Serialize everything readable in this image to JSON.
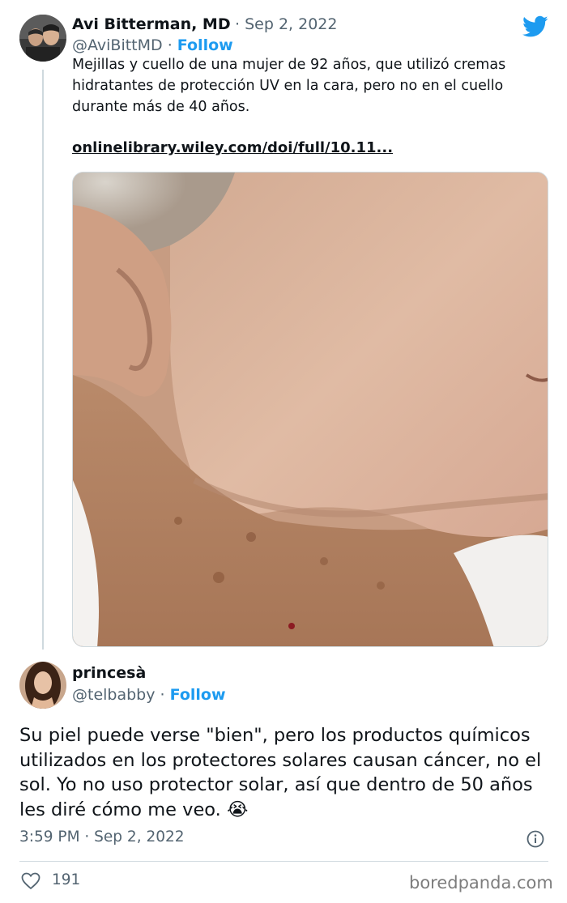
{
  "quoted_tweet": {
    "author_name": "Avi Bitterman, MD",
    "separator": "·",
    "date": "Sep 2, 2022",
    "handle": "@AviBittMD",
    "follow_label": "Follow",
    "text": "Mejillas y cuello de una mujer de 92 años, que utilizó cremas hidratantes de protección UV en la cara, pero no en el cuello durante más de 40 años.",
    "link_text": "onlinelibrary.wiley.com/doi/full/10.11..."
  },
  "reply_tweet": {
    "author_name": "princesà",
    "handle": "@telbabby",
    "separator": "·",
    "follow_label": "Follow",
    "text": "Su piel puede verse \"bien\", pero los productos químicos utilizados en los protectores solares causan cáncer, no el sol. Yo no uso protector solar, así que dentro de 50 años les diré cómo me veo. 😭",
    "timestamp": "3:59 PM · Sep 2, 2022",
    "likes": "191"
  },
  "watermark": "boredpanda.com",
  "icons": {
    "brand": "twitter-bird-icon",
    "info": "info-icon",
    "like": "heart-icon"
  },
  "colors": {
    "accent": "#1d9bf0",
    "secondary_text": "#536471",
    "primary_text": "#0f1419",
    "border": "#cfd9de"
  }
}
